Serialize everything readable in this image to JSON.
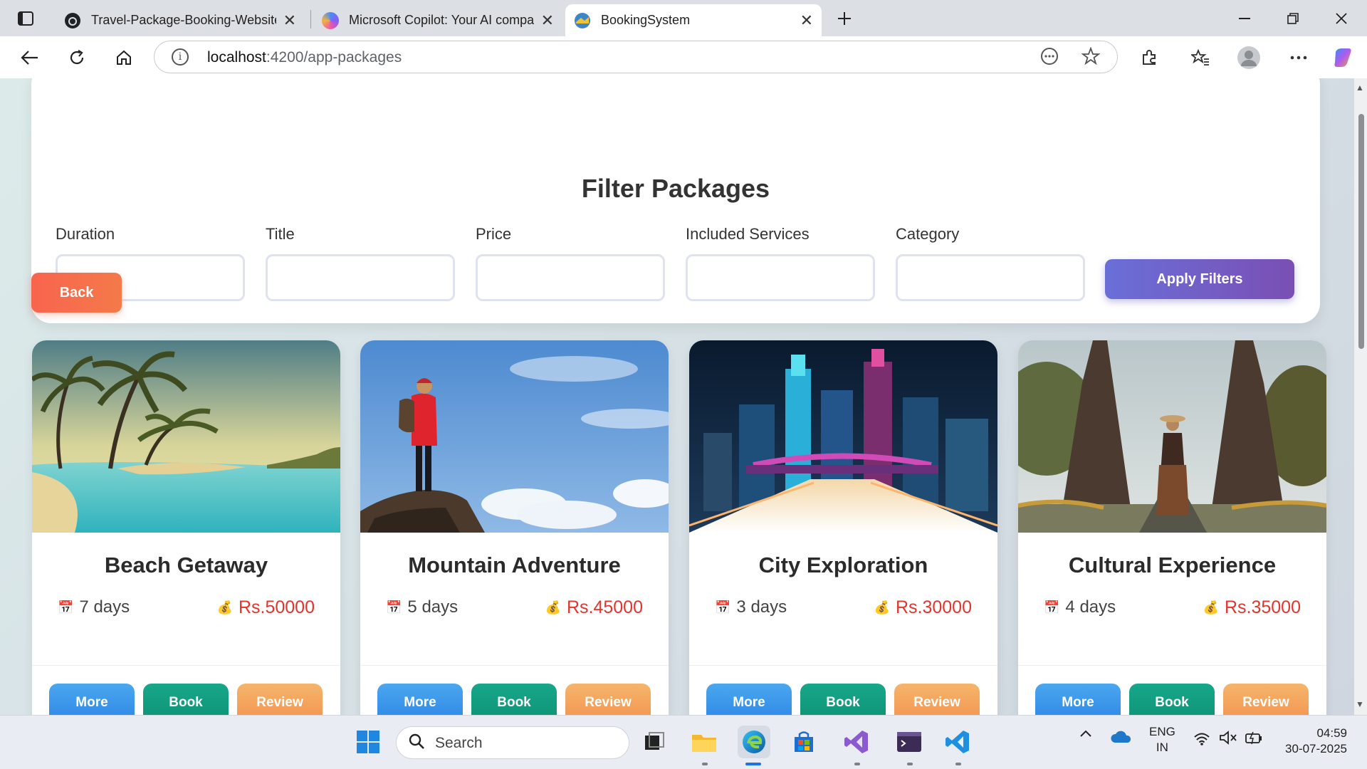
{
  "browser": {
    "tabs": [
      {
        "title": "Travel-Package-Booking-Website",
        "favicon": "github-icon"
      },
      {
        "title": "Microsoft Copilot: Your AI companion",
        "favicon": "copilot-icon"
      },
      {
        "title": "BookingSystem",
        "favicon": "booking-logo-icon",
        "active": true
      }
    ],
    "url_host": "localhost",
    "url_path": ":4200/app-packages"
  },
  "filter": {
    "title": "Filter Packages",
    "fields": [
      {
        "label": "Duration",
        "value": ""
      },
      {
        "label": "Title",
        "value": ""
      },
      {
        "label": "Price",
        "value": ""
      },
      {
        "label": "Included Services",
        "value": ""
      },
      {
        "label": "Category",
        "value": ""
      }
    ],
    "apply_label": "Apply Filters"
  },
  "back_label": "Back",
  "packages": [
    {
      "title": "Beach Getaway",
      "duration": "7 days",
      "price": "Rs.50000",
      "image": "beach-image"
    },
    {
      "title": "Mountain Adventure",
      "duration": "5 days",
      "price": "Rs.45000",
      "image": "mountain-image"
    },
    {
      "title": "City Exploration",
      "duration": "3 days",
      "price": "Rs.30000",
      "image": "city-image"
    },
    {
      "title": "Cultural Experience",
      "duration": "4 days",
      "price": "Rs.35000",
      "image": "temple-image"
    }
  ],
  "card_buttons": {
    "more": "More",
    "book": "Book",
    "review": "Review"
  },
  "taskbar": {
    "search_placeholder": "Search",
    "lang_top": "ENG",
    "lang_bottom": "IN",
    "time": "04:59",
    "date": "30-07-2025"
  },
  "colors": {
    "apply_gradient": [
      "#6a6fd8",
      "#7a4fb4"
    ],
    "back": "#f8644e",
    "more": "#2f86e6",
    "book": "#0e9275",
    "review": "#f29250",
    "price": "#e2352e"
  }
}
